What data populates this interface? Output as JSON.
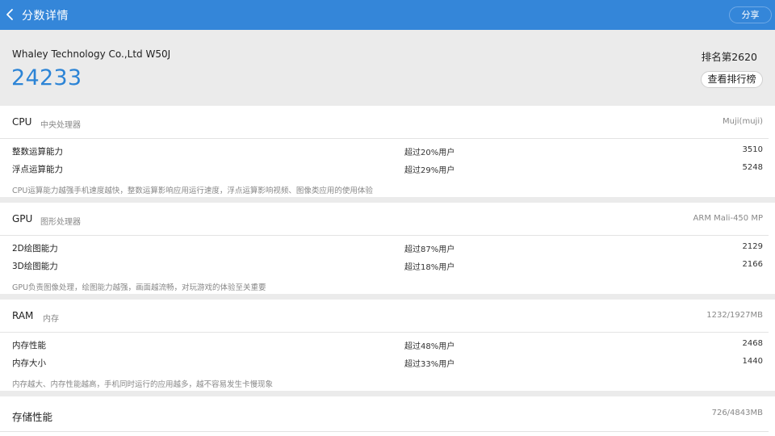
{
  "header": {
    "title": "分数详情",
    "share_label": "分享"
  },
  "summary": {
    "device": "Whaley Technology Co.,Ltd W50J",
    "score": "24233",
    "rank": "排名第2620",
    "rank_button": "查看排行榜"
  },
  "sections": [
    {
      "name": "CPU",
      "subtitle": "中央处理器",
      "value": "Muji(muji)",
      "rows": [
        {
          "label": "整数运算能力",
          "percent": "超过20%用户",
          "score": "3510"
        },
        {
          "label": "浮点运算能力",
          "percent": "超过29%用户",
          "score": "5248"
        }
      ],
      "note": "CPU运算能力越强手机速度越快，整数运算影响应用运行速度，浮点运算影响视频、图像类应用的使用体验"
    },
    {
      "name": "GPU",
      "subtitle": "图形处理器",
      "value": "ARM Mali-450 MP",
      "rows": [
        {
          "label": "2D绘图能力",
          "percent": "超过87%用户",
          "score": "2129"
        },
        {
          "label": "3D绘图能力",
          "percent": "超过18%用户",
          "score": "2166"
        }
      ],
      "note": "GPU负责图像处理，绘图能力越强，画面越流畅，对玩游戏的体验至关重要"
    },
    {
      "name": "RAM",
      "subtitle": "内存",
      "value": "1232/1927MB",
      "rows": [
        {
          "label": "内存性能",
          "percent": "超过48%用户",
          "score": "2468"
        },
        {
          "label": "内存大小",
          "percent": "超过33%用户",
          "score": "1440"
        }
      ],
      "note": "内存越大、内存性能越高，手机同时运行的应用越多，越不容易发生卡慢现象"
    }
  ],
  "storage": {
    "name": "存储性能",
    "value": "726/4843MB"
  },
  "colors": {
    "header_bg": "#3486d9",
    "score_blue": "#2c84d6",
    "page_bg": "#ebebeb"
  }
}
